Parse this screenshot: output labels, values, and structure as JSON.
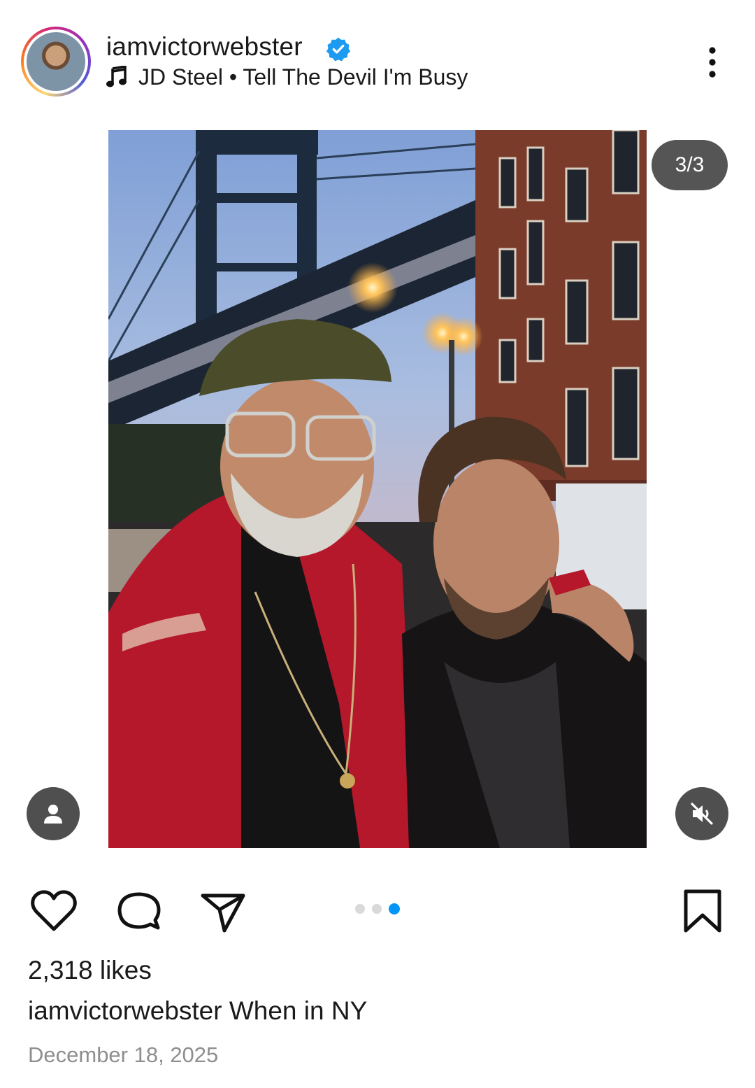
{
  "post": {
    "username": "iamvictorwebster",
    "verified": true,
    "music": {
      "artist": "JD Steel",
      "separator": "•",
      "title": "Tell The Devil I'm Busy",
      "text": "JD Steel • Tell The Devil I'm Busy"
    },
    "counter": "3/3",
    "carousel": {
      "total": 3,
      "current": 3
    },
    "likes": "2,318 likes",
    "caption_user": "iamvictorwebster",
    "caption_text": " When in NY",
    "date": "December 18, 2025"
  },
  "icons": {
    "avatar": "avatar",
    "verified": "verified-badge-icon",
    "music": "music-note-icon",
    "more": "more-vertical-icon",
    "tag": "person-tag-icon",
    "mute": "muted-speaker-icon",
    "like": "heart-icon",
    "comment": "comment-bubble-icon",
    "share": "paper-plane-icon",
    "save": "bookmark-icon"
  },
  "colors": {
    "accent_blue": "#0095f6",
    "verified_blue": "#1d9bf0",
    "muted_text": "#8e8e8e",
    "overlay": "#464646"
  }
}
